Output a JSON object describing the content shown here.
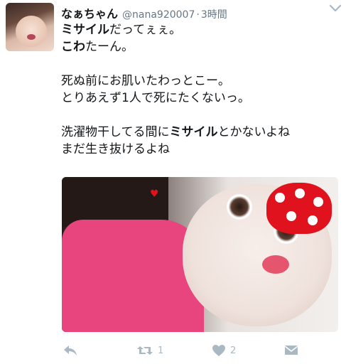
{
  "tweet": {
    "display_name": "なぁちゃん",
    "handle": "@nana920007",
    "separator": "·",
    "time": "3時間",
    "lines": [
      {
        "parts": [
          {
            "text": "ミサイル",
            "bold": true
          },
          {
            "text": "だってぇぇ。",
            "bold": false
          }
        ]
      },
      {
        "parts": [
          {
            "text": "こわ",
            "bold": true
          },
          {
            "text": "たーん。",
            "bold": false
          }
        ]
      },
      {
        "gap": true
      },
      {
        "parts": [
          {
            "text": "死ぬ前にお肌いたわっとこー。",
            "bold": false
          }
        ]
      },
      {
        "parts": [
          {
            "text": "とりあえず1人で死にたくないっ。",
            "bold": false
          }
        ]
      },
      {
        "gap": true
      },
      {
        "parts": [
          {
            "text": "洗濯物干してる間に",
            "bold": false
          },
          {
            "text": "ミサイル",
            "bold": true
          },
          {
            "text": "とかないよね",
            "bold": false
          }
        ]
      },
      {
        "parts": [
          {
            "text": "まだ生き抜けるよね",
            "bold": false
          }
        ]
      }
    ],
    "actions": {
      "reply_icon": "reply-icon",
      "retweet_icon": "retweet-icon",
      "retweet_count": "1",
      "like_icon": "heart-icon",
      "like_count": "2",
      "dm_icon": "envelope-icon"
    }
  },
  "colors": {
    "text": "#14171a",
    "muted": "#657786",
    "action": "#aab8c2"
  }
}
